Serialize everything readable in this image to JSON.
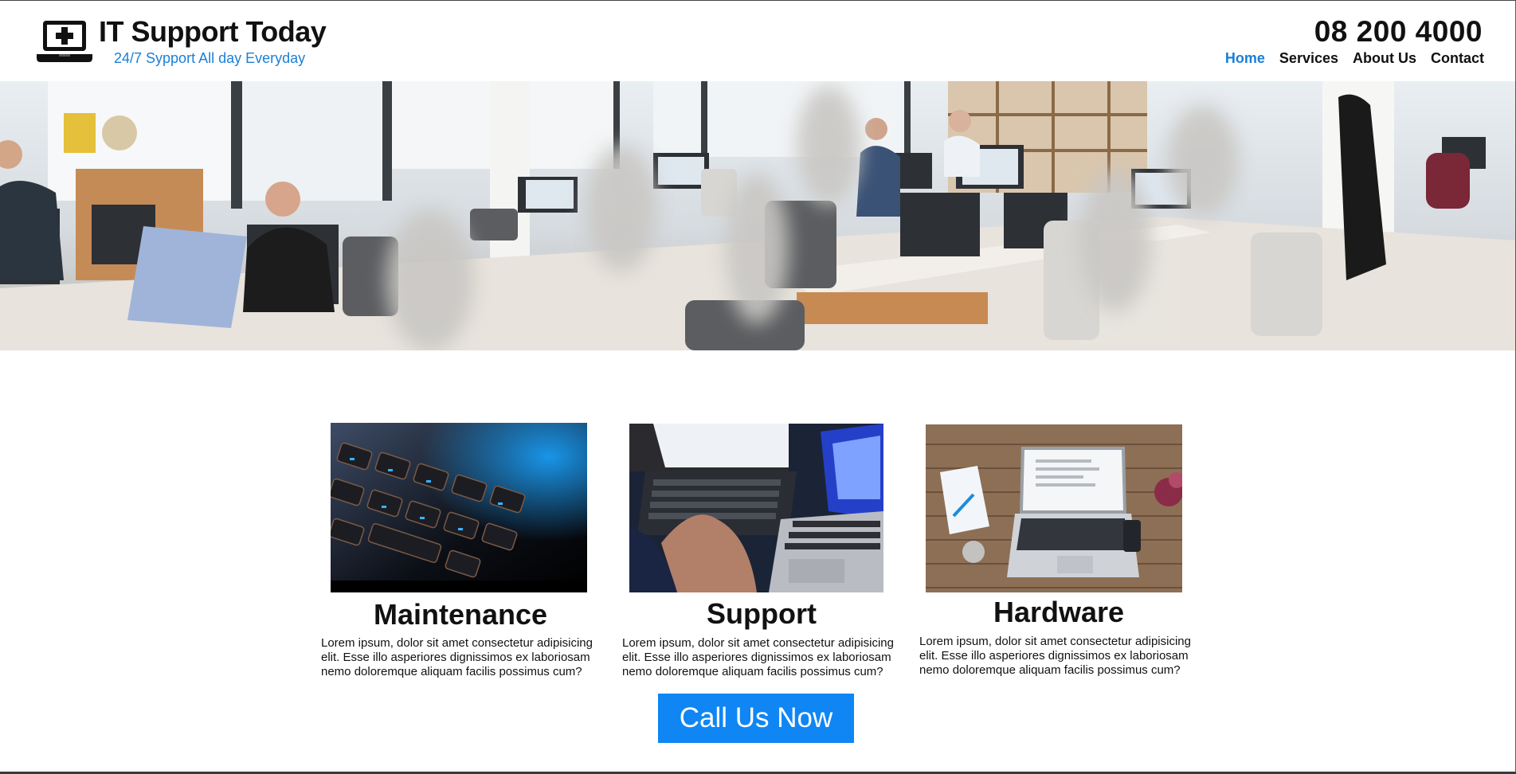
{
  "brand": {
    "title": "IT Support Today",
    "tagline": "24/7 Sypport All day Everyday",
    "icon": "laptop-medical-icon"
  },
  "phone": "08 200 4000",
  "nav": {
    "items": [
      {
        "label": "Home",
        "active": true
      },
      {
        "label": "Services",
        "active": false
      },
      {
        "label": "About Us",
        "active": false
      },
      {
        "label": "Contact",
        "active": false
      }
    ]
  },
  "hero": {
    "image": "office-workspace-photo"
  },
  "cards": [
    {
      "title": "Maintenance",
      "image": "backlit-keyboard-photo",
      "text": "Lorem ipsum, dolor sit amet consectetur adipisicing elit. Esse illo asperiores dignissimos ex laboriosam nemo doloremque aliquam facilis possimus cum?"
    },
    {
      "title": "Support",
      "image": "hands-on-laptops-photo",
      "text": "Lorem ipsum, dolor sit amet consectetur adipisicing elit. Esse illo asperiores dignissimos ex laboriosam nemo doloremque aliquam facilis possimus cum?"
    },
    {
      "title": "Hardware",
      "image": "laptop-on-wooden-desk-photo",
      "text": "Lorem ipsum, dolor sit amet consectetur adipisicing elit. Esse illo asperiores dignissimos ex laboriosam nemo doloremque aliquam facilis possimus cum?"
    }
  ],
  "cta": {
    "label": "Call Us Now"
  },
  "colors": {
    "accent": "#1a7fd8",
    "button": "#0f86f4",
    "text": "#111111"
  }
}
